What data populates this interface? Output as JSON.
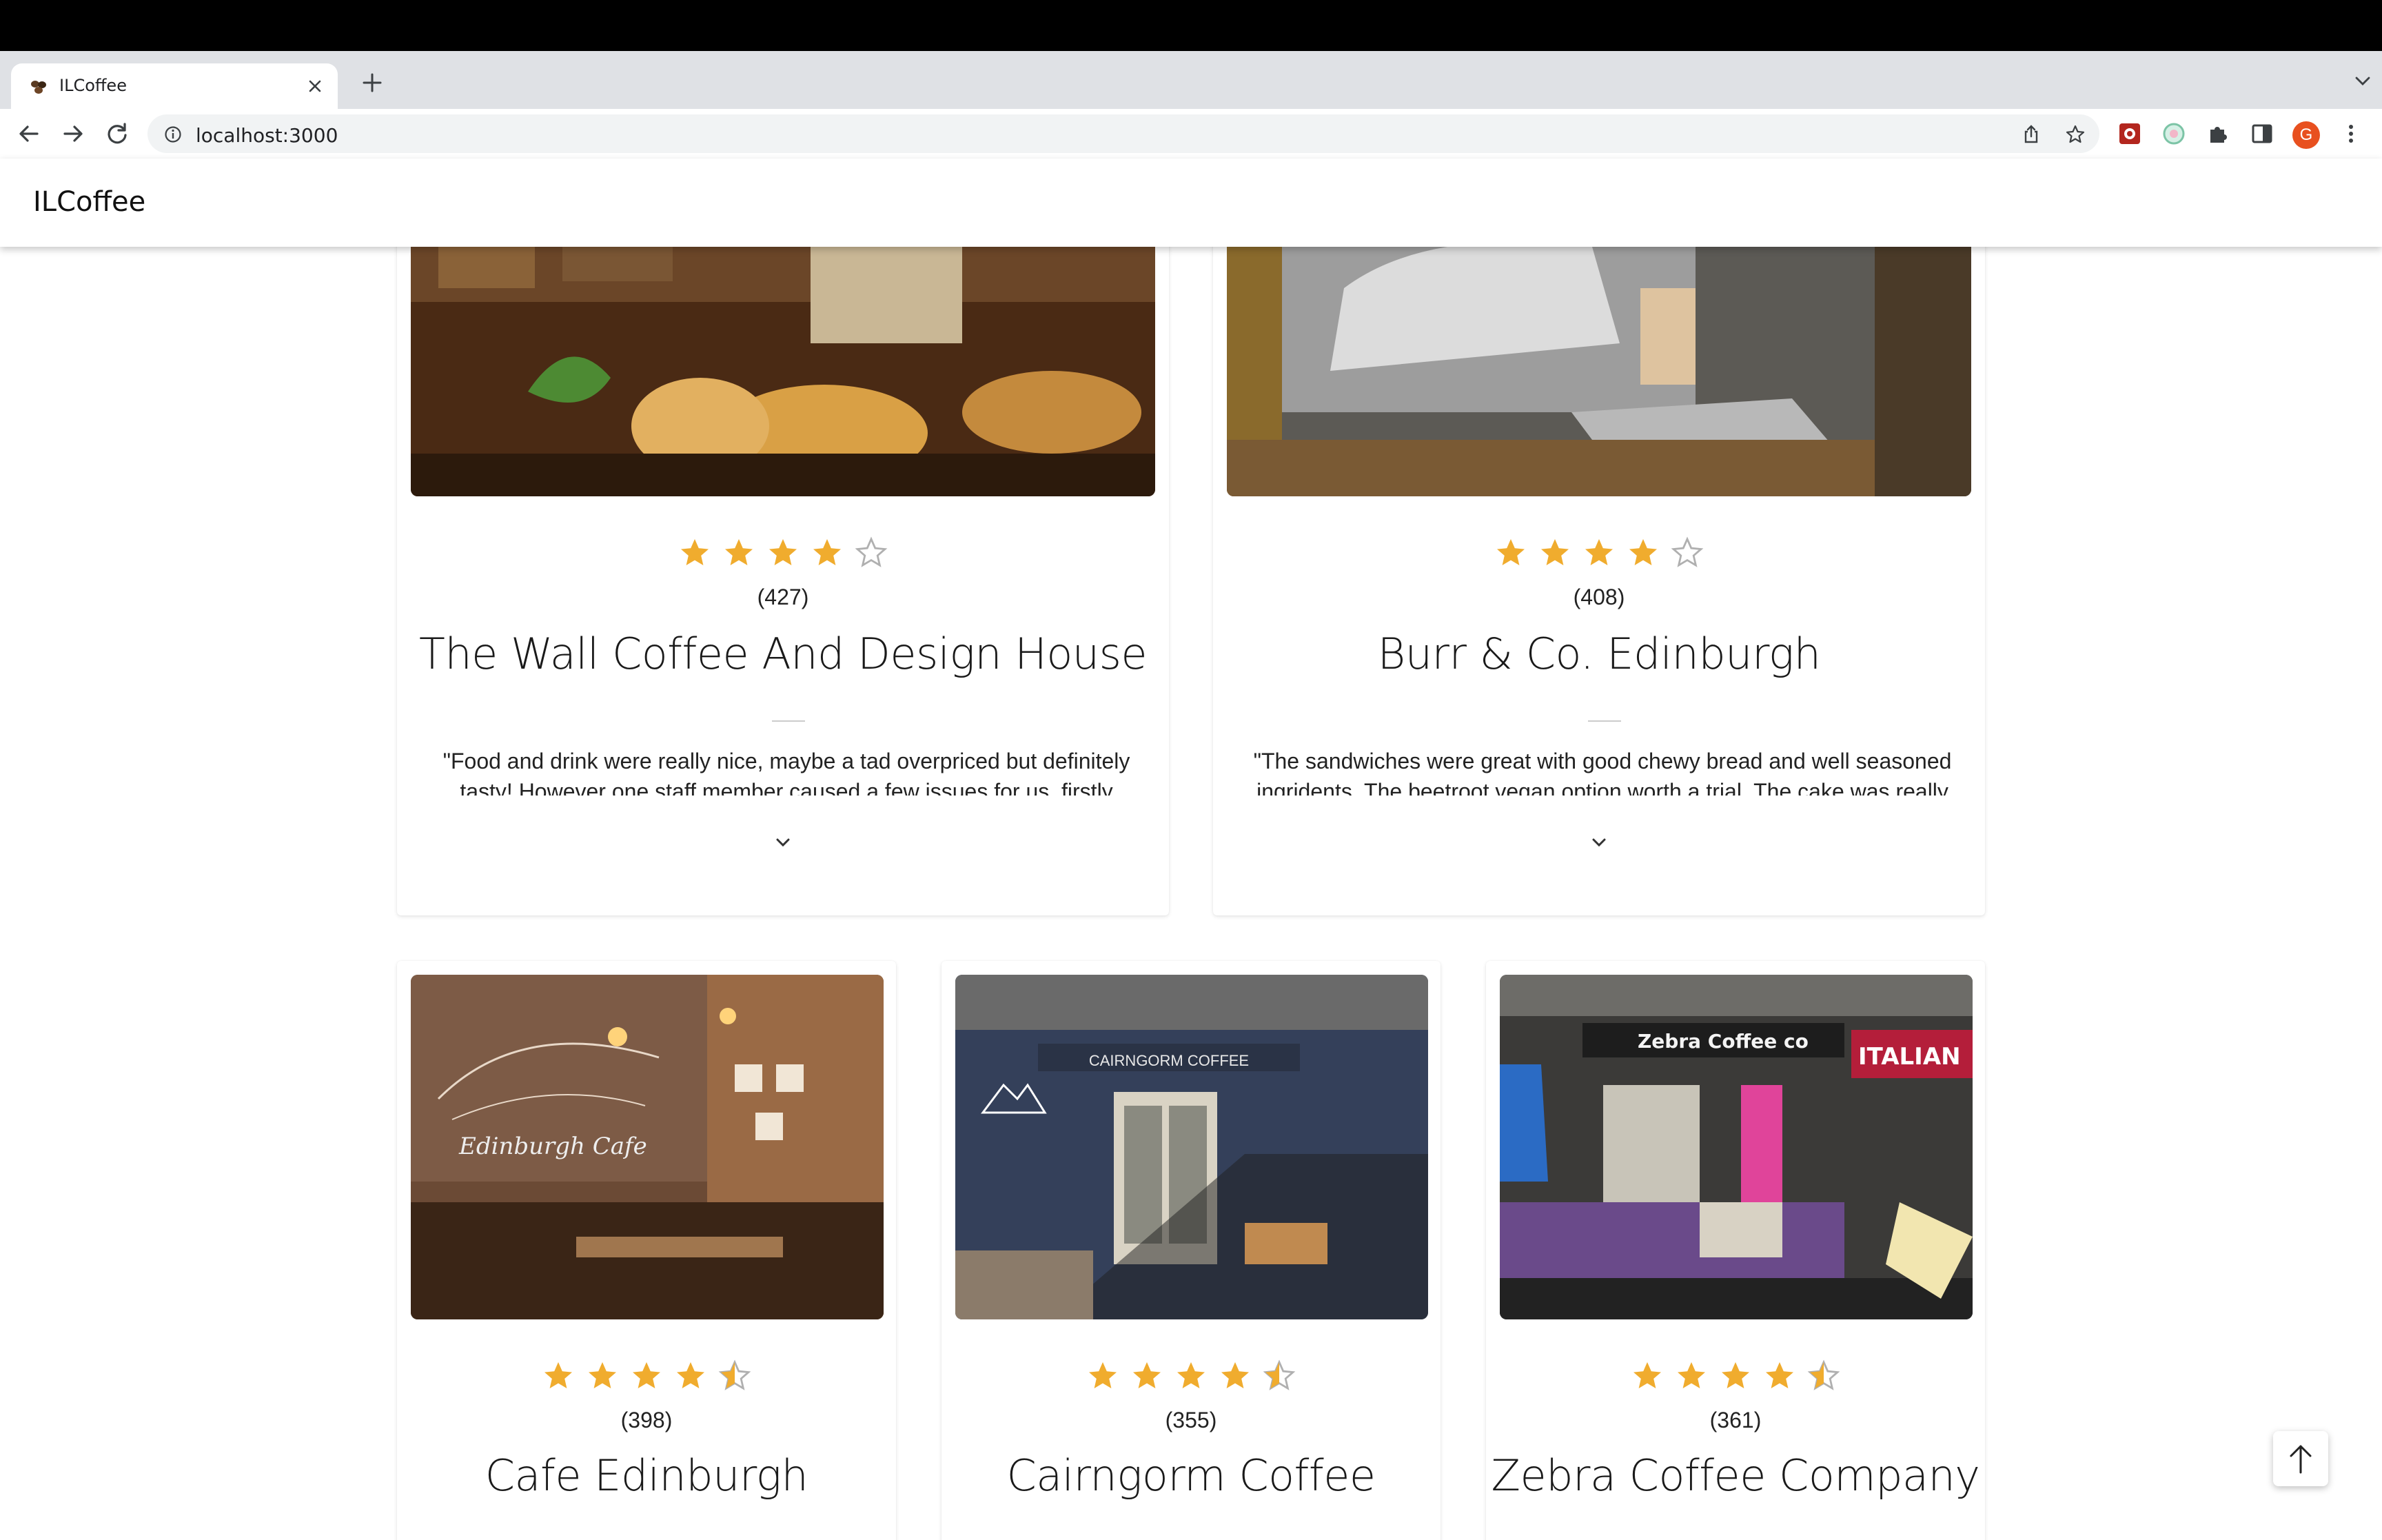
{
  "browser": {
    "tab_title": "ILCoffee",
    "url": "localhost:3000",
    "profile_initial": "G"
  },
  "app": {
    "brand": "ILCoffee"
  },
  "colors": {
    "star": "#f0ac2e",
    "star_empty": "#b0b0b0"
  },
  "cards": [
    {
      "name": "The Wall Coffee And Design House",
      "rating": 4,
      "count": "(427)",
      "review": "\"Food and drink were really nice, maybe a tad overpriced but definitely tasty! However one staff member caused a few issues for us, firstly"
    },
    {
      "name": "Burr & Co. Edinburgh",
      "rating": 4,
      "count": "(408)",
      "review": "\"The sandwiches were great with good chewy bread and well seasoned ingridents. The beetroot vegan option worth a trial. The cake was really"
    },
    {
      "name": "Cafe Edinburgh",
      "rating": 4.5,
      "count": "(398)"
    },
    {
      "name": "Cairngorm Coffee",
      "rating": 4.5,
      "count": "(355)"
    },
    {
      "name": "Zebra Coffee Company",
      "rating": 4.5,
      "count": "(361)"
    }
  ],
  "photo_signs": {
    "cairngorm": "CAIRNGORM COFFEE",
    "zebra": "Zebra Coffee co",
    "italian": "ITALIAN",
    "edinburgh": "Edinburgh Cafe"
  }
}
